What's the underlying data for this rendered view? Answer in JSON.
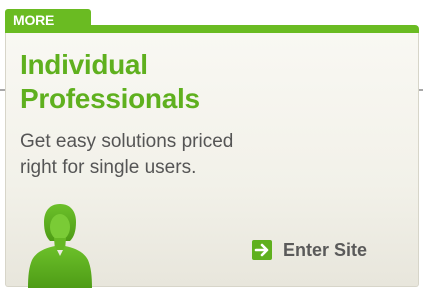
{
  "card": {
    "tab_label": "MORE",
    "title_line1": "Individual",
    "title_line2": "Professionals",
    "desc_line1": "Get easy solutions priced",
    "desc_line2": "right for single users.",
    "cta_label": "Enter Site",
    "cta_icon": "arrow-right-icon",
    "person_icon": "person-silhouette-icon"
  },
  "colors": {
    "accent": "#6abb22",
    "title": "#5fb01e",
    "body_text": "#555555",
    "panel_bg": "#f2f1e9",
    "rule": "#a8a8a8"
  }
}
